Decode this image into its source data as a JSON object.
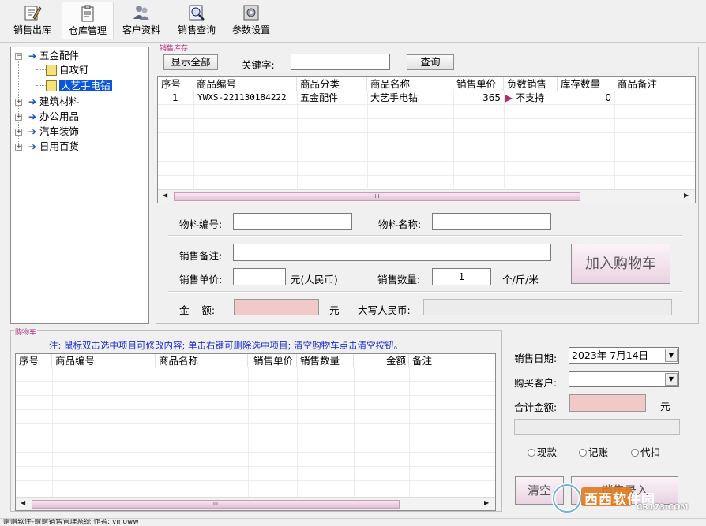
{
  "toolbar": [
    {
      "label": "销售出库",
      "icon": "edit-doc-icon"
    },
    {
      "label": "仓库管理",
      "icon": "clipboard-icon"
    },
    {
      "label": "客户资料",
      "icon": "users-icon"
    },
    {
      "label": "销售查询",
      "icon": "magnifier-icon"
    },
    {
      "label": "参数设置",
      "icon": "settings-icon"
    }
  ],
  "tree": {
    "root1": "五金配件",
    "child1": "自攻钉",
    "child2": "大艺手电钻",
    "root2": "建筑材料",
    "root3": "办公用品",
    "root4": "汽车装饰",
    "root5": "日用百货"
  },
  "inventory": {
    "title": "销售库存",
    "show_all": "显示全部",
    "keyword_label": "关键字:",
    "keyword_value": "",
    "query": "查询",
    "columns": [
      "序号",
      "商品编号",
      "商品分类",
      "商品名称",
      "销售单价",
      "负数销售",
      "库存数量",
      "商品备注"
    ],
    "rows": [
      {
        "no": "1",
        "code": "YWXS-221130184222",
        "category": "五金配件",
        "name": "大艺手电钻",
        "price": "365",
        "negative": "不支持",
        "stock": "0",
        "remark": ""
      }
    ],
    "scroll_grip": "III"
  },
  "form": {
    "item_code_label": "物料编号:",
    "item_code": "",
    "item_name_label": "物料名称:",
    "item_name": "",
    "remark_label": "销售备注:",
    "remark": "",
    "price_label": "销售单价:",
    "price": "",
    "price_unit": "元(人民币)",
    "qty_label": "销售数量:",
    "qty": "1",
    "qty_unit": "个/斤/米",
    "add_cart": "加入购物车",
    "amount_label": "金    额:",
    "amount": "",
    "amount_unit": "元",
    "upper_label": "大写人民币:",
    "upper": ""
  },
  "cart": {
    "title": "购物车",
    "note": "注: 鼠标双击选中项目可修改内容; 单击右键可删除选中项目; 清空购物车点击清空按钮。",
    "columns": [
      "序号",
      "商品编号",
      "商品名称",
      "销售单价",
      "销售数量",
      "金额",
      "备注"
    ],
    "scroll_grip": "III"
  },
  "side": {
    "date_label": "销售日期:",
    "date": "2023年 7月14日",
    "customer_label": "购买客户:",
    "customer": "",
    "total_label": "合计金额:",
    "total": "",
    "total_unit": "元",
    "pay_cash": "现款",
    "pay_credit": "记账",
    "pay_agent": "代扣",
    "clear": "清空",
    "submit": "销售录入"
  },
  "status_text": "赠赠软件-赠赠销售管理系统 作者: vinoww",
  "watermark": {
    "brand": "西西软件园",
    "site": "CR173.COM"
  },
  "colors": {
    "selection": "#0a55d9",
    "pink_field": "#f2c9c9",
    "note_blue": "#1a2fd0",
    "group_title": "#b2267a"
  }
}
